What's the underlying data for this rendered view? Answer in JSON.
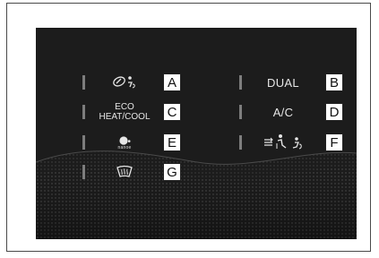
{
  "panel": {
    "buttons": [
      {
        "icon": "lexus-climate-icon",
        "callout": "A"
      },
      {
        "label": "DUAL",
        "callout": "B"
      },
      {
        "label_line1": "ECO",
        "label_line2": "HEAT/COOL",
        "callout": "C"
      },
      {
        "label": "A/C",
        "callout": "D"
      },
      {
        "icon": "nanoe-icon",
        "icon_label": "nanoe",
        "callout": "E"
      },
      {
        "icon": "airflow-mode-icon",
        "callout": "F"
      },
      {
        "icon": "front-defroster-icon",
        "callout": "G"
      }
    ]
  },
  "colors": {
    "screen_background": "#1c1c1c",
    "indicator_bar": "#7d7d7d",
    "label_text": "#e6e6e6",
    "callout_box": "#ffffff"
  }
}
